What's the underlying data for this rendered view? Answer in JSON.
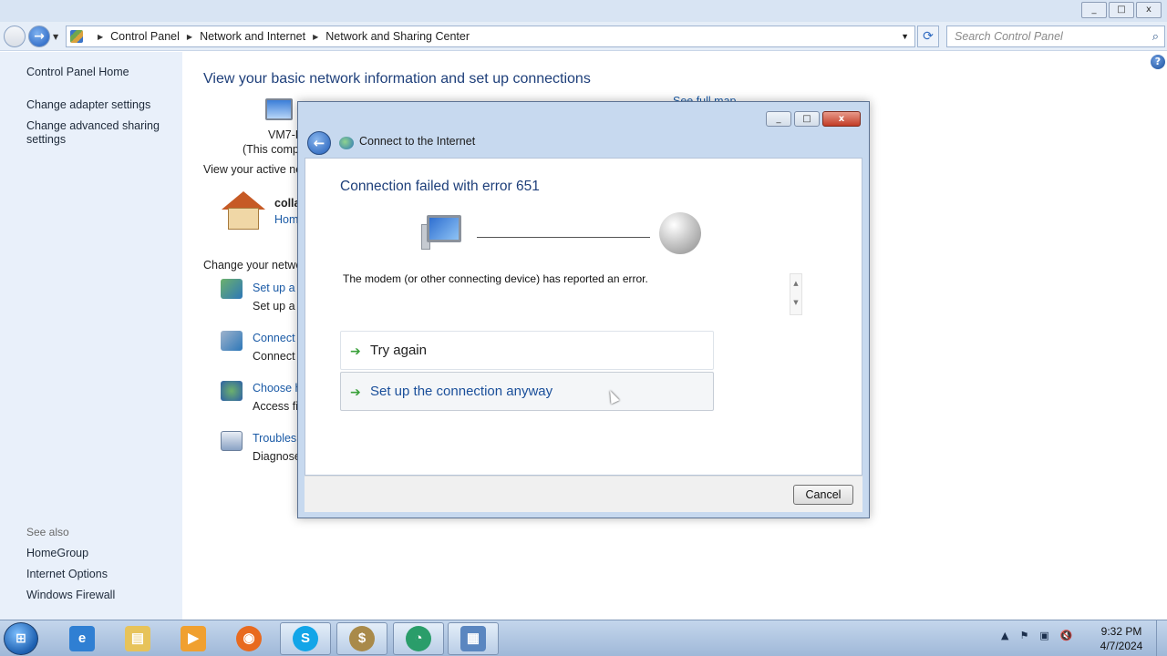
{
  "window": {
    "controls": [
      "_",
      "□",
      "x"
    ]
  },
  "nav": {
    "breadcrumbs": [
      "Control Panel",
      "Network and Internet",
      "Network and Sharing Center"
    ],
    "search_placeholder": "Search Control Panel"
  },
  "sidebar": {
    "home": "Control Panel Home",
    "links": [
      "Change adapter settings",
      "Change advanced sharing settings"
    ],
    "see_also_label": "See also",
    "see_also": [
      "HomeGroup",
      "Internet Options",
      "Windows Firewall"
    ]
  },
  "main": {
    "title": "View your basic network information and set up connections",
    "see_full_map": "See full map",
    "computer_name": "VM7-P",
    "this_computer": "(This comp",
    "active_networks_label": "View your active ne",
    "network_name": "colla",
    "network_type": "Hom",
    "change_settings_label": "Change your netwo",
    "tasks": [
      {
        "link": "Set up a r",
        "desc": "Set up a v"
      },
      {
        "link": "Connect",
        "desc": "Connect"
      },
      {
        "link": "Choose h",
        "desc": "Access fil"
      },
      {
        "link": "Troublesh",
        "desc": "Diagnose"
      }
    ]
  },
  "dialog": {
    "title": "Connect to the Internet",
    "heading": "Connection failed with error 651",
    "message": "The modem (or other connecting device) has reported an error.",
    "options": [
      {
        "label": "Try again"
      },
      {
        "label": "Set up the connection anyway"
      }
    ],
    "cancel_label": "Cancel"
  },
  "taskbar": {
    "apps": [
      "ie",
      "explorer",
      "media-player",
      "firefox",
      "skype",
      "money",
      "app",
      "network"
    ],
    "time": "9:32 PM",
    "date": "4/7/2024"
  },
  "colors": {
    "link": "#1a5aa6",
    "heading": "#1e3f7a",
    "sidebar_bg": "#e9f0fa",
    "arrow_green": "#3ba13b"
  }
}
